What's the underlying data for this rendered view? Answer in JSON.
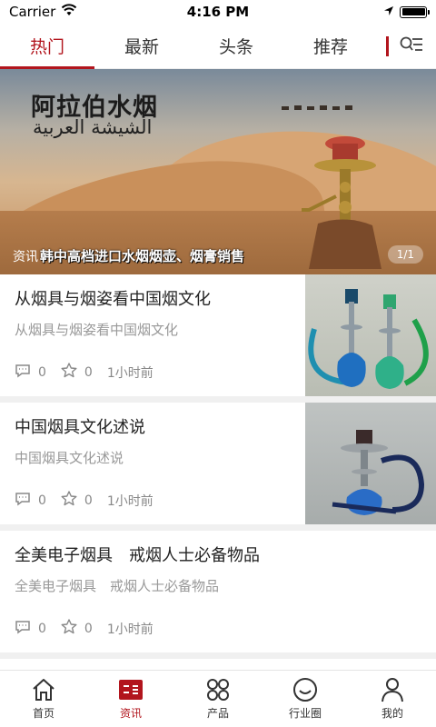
{
  "status_bar": {
    "carrier": "Carrier",
    "time": "4:16 PM",
    "icons": [
      "wifi-icon",
      "location-arrow-icon",
      "battery-icon"
    ],
    "battery_level": 1.0
  },
  "tabs": [
    {
      "label": "热门",
      "active": true
    },
    {
      "label": "最新",
      "active": false
    },
    {
      "label": "头条",
      "active": false
    },
    {
      "label": "推荐",
      "active": false
    }
  ],
  "tab_menu_icon": "category-list-icon",
  "banner": {
    "title": "阿拉伯水烟",
    "subtitle_arabic": "الشيشة العربية",
    "caption_tag": "资讯",
    "caption_text": "韩中高档进口水烟烟壶、烟膏销售",
    "pager": "1/1"
  },
  "articles": [
    {
      "title": "从烟具与烟姿看中国烟文化",
      "subtitle": "从烟具与烟姿看中国烟文化",
      "comments": "0",
      "likes": "0",
      "time": "1小时前",
      "has_image": true
    },
    {
      "title": "中国烟具文化述说",
      "subtitle": "中国烟具文化述说",
      "comments": "0",
      "likes": "0",
      "time": "1小时前",
      "has_image": true
    },
    {
      "title": "全美电子烟具　戒烟人士必备物品",
      "subtitle": "全美电子烟具　戒烟人士必备物品",
      "comments": "0",
      "likes": "0",
      "time": "1小时前",
      "has_image": false
    }
  ],
  "bottom_nav": [
    {
      "label": "首页",
      "icon": "home-icon",
      "active": false
    },
    {
      "label": "资讯",
      "icon": "news-icon",
      "active": true
    },
    {
      "label": "产品",
      "icon": "grid-icon",
      "active": false
    },
    {
      "label": "行业圈",
      "icon": "smile-icon",
      "active": false
    },
    {
      "label": "我的",
      "icon": "user-icon",
      "active": false
    }
  ],
  "colors": {
    "accent": "#b2151d",
    "muted_text": "#999999",
    "separator": "#f0f0f0"
  }
}
